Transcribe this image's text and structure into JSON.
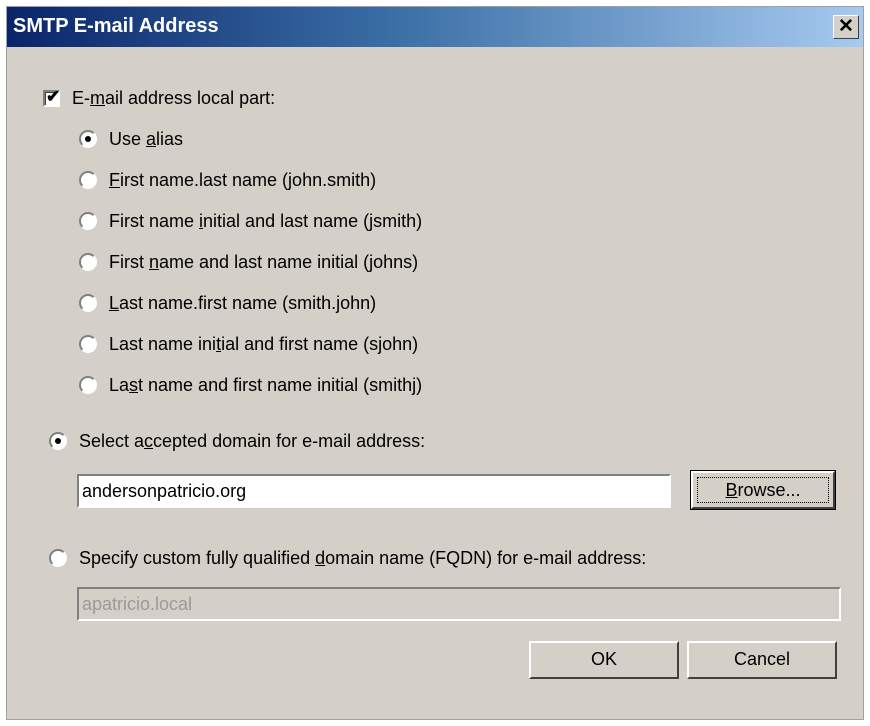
{
  "window": {
    "title": "SMTP E-mail Address",
    "close_glyph": "✕"
  },
  "local_part": {
    "checked": true,
    "label_pre": "E-",
    "label_ul": "m",
    "label_post": "ail address local part:",
    "options": [
      {
        "pre": "Use ",
        "ul": "a",
        "post": "lias",
        "selected": true
      },
      {
        "pre": "",
        "ul": "F",
        "post": "irst name.last name (john.smith)",
        "selected": false
      },
      {
        "pre": "First name ",
        "ul": "i",
        "post": "nitial and last name (jsmith)",
        "selected": false
      },
      {
        "pre": "First ",
        "ul": "n",
        "post": "ame and last name initial (johns)",
        "selected": false
      },
      {
        "pre": "",
        "ul": "L",
        "post": "ast name.first name (smith.john)",
        "selected": false
      },
      {
        "pre": "Last name ini",
        "ul": "t",
        "post": "ial and first name (sjohn)",
        "selected": false
      },
      {
        "pre": "La",
        "ul": "s",
        "post": "t name and first name initial (smithj)",
        "selected": false
      }
    ]
  },
  "accepted_domain": {
    "selected": true,
    "label_pre": "Select a",
    "label_ul": "c",
    "label_post": "cepted domain for e-mail address:",
    "value": "andersonpatricio.org",
    "browse_pre": "",
    "browse_ul": "B",
    "browse_post": "rowse..."
  },
  "custom_fqdn": {
    "selected": false,
    "label_pre": "Specify custom fully qualified ",
    "label_ul": "d",
    "label_post": "omain name (FQDN) for e-mail address:",
    "value": "apatricio.local"
  },
  "buttons": {
    "ok": "OK",
    "cancel": "Cancel"
  },
  "colors": {
    "dialog_bg": "#d4d0c8",
    "title_start": "#0a246a",
    "title_end": "#a6caf0"
  }
}
